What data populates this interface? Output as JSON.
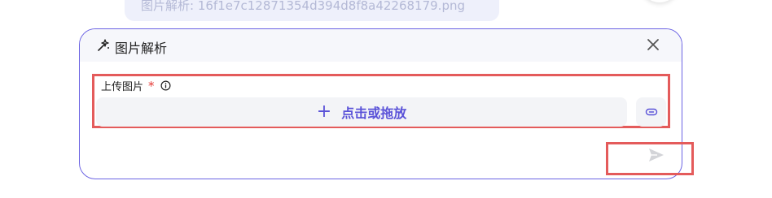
{
  "prev_message": {
    "text": "图片解析: 16f1e7c12871354d394d8f8a42268179.png"
  },
  "panel": {
    "title": "图片解析",
    "icon": "sparkle-icon",
    "accent_color": "#6b63e3"
  },
  "upload": {
    "label": "上传图片",
    "required_mark": "*",
    "dropzone_plus": "+",
    "dropzone_label": "点击或拖放",
    "text_color": "#5a52d8"
  },
  "actions": {
    "link_icon": "link-icon",
    "send_icon": "send-icon",
    "close_icon": "close-icon"
  },
  "highlight_color": "#e45b5b"
}
